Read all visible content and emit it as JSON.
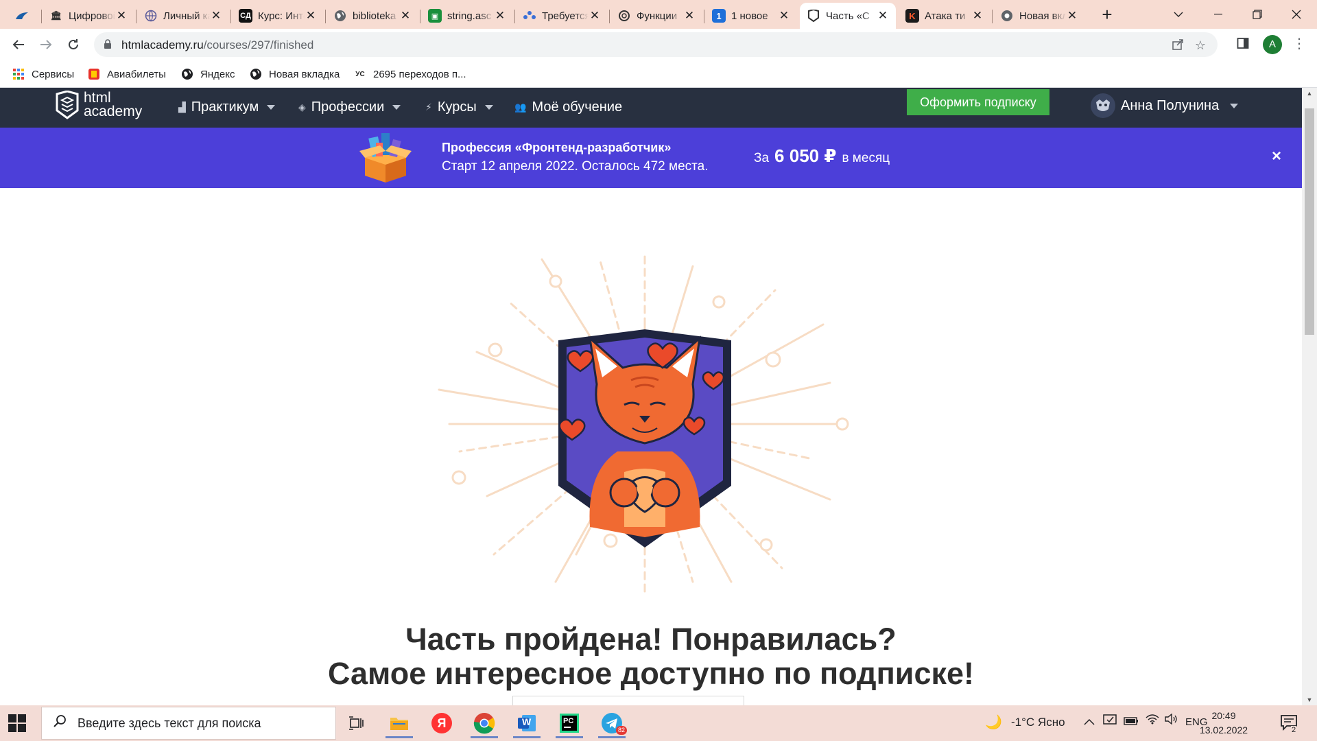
{
  "browser": {
    "tabs": [
      {
        "title": "Цифровой"
      },
      {
        "title": "Личный кабинет"
      },
      {
        "title": "Курс: Интенсив"
      },
      {
        "title": "biblioteka"
      },
      {
        "title": "string.asc"
      },
      {
        "title": "Требуется"
      },
      {
        "title": "Функции"
      },
      {
        "title": "1 новое"
      },
      {
        "title": "Часть «С"
      },
      {
        "title": "Атака ти"
      },
      {
        "title": "Новая вкладка"
      }
    ],
    "active_tab_index": 8,
    "url_host": "htmlacademy.ru",
    "url_path": "/courses/297/finished",
    "profile_letter": "A",
    "bookmarks": [
      {
        "label": "Сервисы",
        "icon": "apps-grid-icon"
      },
      {
        "label": "Авиабилеты",
        "icon": "plane-tickets-icon"
      },
      {
        "label": "Яндекс",
        "icon": "globe-icon"
      },
      {
        "label": "Новая вкладка",
        "icon": "globe-icon"
      },
      {
        "label": "2695 переходов п...",
        "icon": "counter-icon"
      }
    ]
  },
  "site": {
    "logo_line1": "html",
    "logo_line2": "academy",
    "nav": [
      {
        "label": "Практикум",
        "icon": "chart-icon",
        "has_dropdown": true
      },
      {
        "label": "Профессии",
        "icon": "graduation-cap-icon",
        "has_dropdown": true
      },
      {
        "label": "Курсы",
        "icon": "lightning-icon",
        "has_dropdown": true
      },
      {
        "label": "Моё обучение",
        "icon": "people-icon",
        "has_dropdown": false
      }
    ],
    "subscribe_label": "Оформить подписку",
    "user_name": "Анна Полунина",
    "colors": {
      "header_bg": "#283040",
      "promo_bg": "#4c3fd9",
      "subscribe_bg": "#3fae49"
    }
  },
  "promo": {
    "title": "Профессия «Фронтенд-разработчик»",
    "subtitle": "Старт 12 апреля 2022. Осталось 472 места.",
    "price_prefix": "За",
    "price_value": "6 050 ₽",
    "price_suffix": "в месяц",
    "close_symbol": "×"
  },
  "main": {
    "heading_line1": "Часть пройдена! Понравилась?",
    "heading_line2": "Самое интересное доступно по подписке!"
  },
  "taskbar": {
    "search_placeholder": "Введите здесь текст для поиска",
    "weather": "-1°C  Ясно",
    "language": "ENG",
    "time": "20:49",
    "date": "13.02.2022",
    "telegram_badge": "82",
    "notifications_count": "2",
    "yandex_letter": "Я",
    "word_letter": "W",
    "pycharm_letters": "PC"
  }
}
